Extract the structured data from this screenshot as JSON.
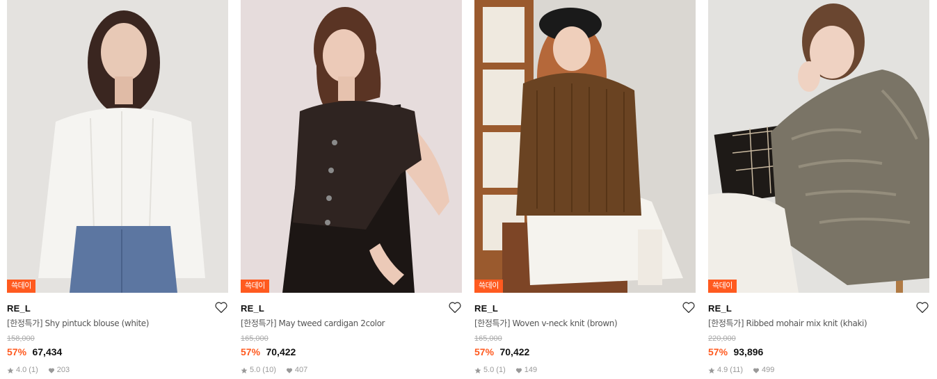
{
  "products": [
    {
      "badge": "쓱데이",
      "brand": "RE_L",
      "title": "[한정특가] Shy pintuck blouse (white)",
      "original_price": "158,000",
      "discount": "57%",
      "price": "67,434",
      "rating": "4.0",
      "review_count": "(1)",
      "likes": "203",
      "image_desc": "model-white-blouse-jeans"
    },
    {
      "badge": "쓱데이",
      "brand": "RE_L",
      "title": "[한정특가] May tweed cardigan 2color",
      "original_price": "165,000",
      "discount": "57%",
      "price": "70,422",
      "rating": "5.0",
      "review_count": "(10)",
      "likes": "407",
      "image_desc": "model-black-tweed-cardigan"
    },
    {
      "badge": "쓱데이",
      "brand": "RE_L",
      "title": "[한정특가] Woven v-neck knit (brown)",
      "original_price": "165,000",
      "discount": "57%",
      "price": "70,422",
      "rating": "5.0",
      "review_count": "(1)",
      "likes": "149",
      "image_desc": "model-brown-knit-beret"
    },
    {
      "badge": "쓱데이",
      "brand": "RE_L",
      "title": "[한정특가] Ribbed mohair mix knit (khaki)",
      "original_price": "220,000",
      "discount": "57%",
      "price": "93,896",
      "rating": "4.9",
      "review_count": "(11)",
      "likes": "499",
      "image_desc": "model-khaki-mohair-knit"
    }
  ],
  "colors": {
    "accent": "#ff5a1f",
    "text": "#111111",
    "muted": "#999999"
  },
  "icons": {
    "wishlist": "heart-outline-icon",
    "rating": "star-icon",
    "likes": "heart-filled-icon"
  }
}
